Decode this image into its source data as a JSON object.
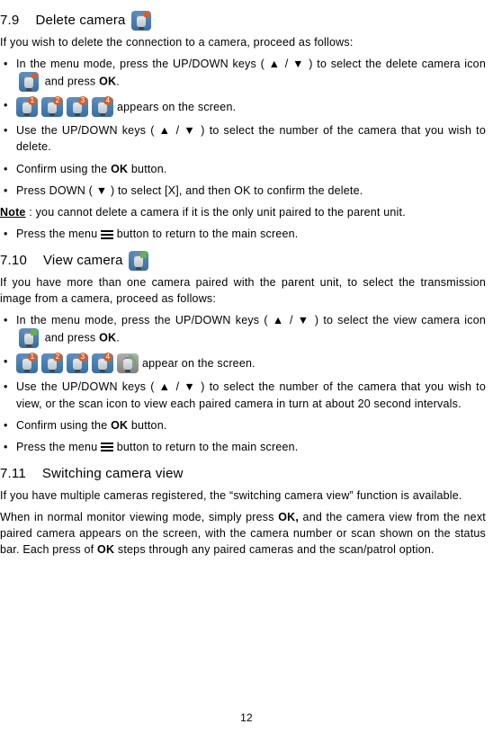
{
  "sections": {
    "s79": {
      "num": "7.9",
      "title": "Delete camera",
      "intro": "If you wish to delete the connection to a camera, proceed as follows:",
      "b1a": "In the menu mode, press the UP/DOWN keys ( ▲ / ▼ ) to select the delete camera icon",
      "b1b": "and press",
      "b1c": ".",
      "ok": "OK",
      "b2": "appears on the screen.",
      "b3": "Use the UP/DOWN keys ( ▲ / ▼ ) to select the number of the camera that you wish to delete.",
      "b4a": "Confirm using the",
      "b4b": "button.",
      "b5": "Press DOWN ( ▼ ) to select [X], and then OK to confirm the delete.",
      "note_label": "Note",
      "note_text": " : you cannot delete a camera if it is the only unit paired to the parent unit.",
      "b6a": "Press the menu",
      "b6b": "button to return to the main screen."
    },
    "s710": {
      "num": "7.10",
      "title": "View camera",
      "intro": "If you have more than one camera paired with the parent unit, to select the transmission image from a camera, proceed as follows:",
      "b1a": "In the menu mode, press the UP/DOWN keys ( ▲ / ▼ ) to select the view camera icon",
      "b1b": "and press",
      "b1c": ".",
      "ok": "OK",
      "b2": "appear on the screen.",
      "b3": "Use the UP/DOWN keys ( ▲ / ▼ ) to select the number of the camera that you wish to view, or the scan icon to view each paired camera in turn at about 20 second intervals.",
      "b4a": "Confirm using the",
      "b4b": "button.",
      "b5a": "Press the menu",
      "b5b": "button to return to the main screen."
    },
    "s711": {
      "num": "7.11",
      "title": "Switching camera view",
      "p1": "If you have multiple cameras registered, the “switching camera view” function is available.",
      "p2a": "When in normal monitor viewing mode, simply press",
      "p2b": "and the camera view from the next  paired camera appears on the screen, with the camera number or scan shown on the status bar.  Each press of",
      "p2c": "steps through any paired cameras and the scan/patrol option.",
      "ok_comma": "OK,",
      "ok": "OK"
    }
  },
  "badges": {
    "n1": "1",
    "n2": "2",
    "n3": "3",
    "n4": "4"
  },
  "page": "12"
}
